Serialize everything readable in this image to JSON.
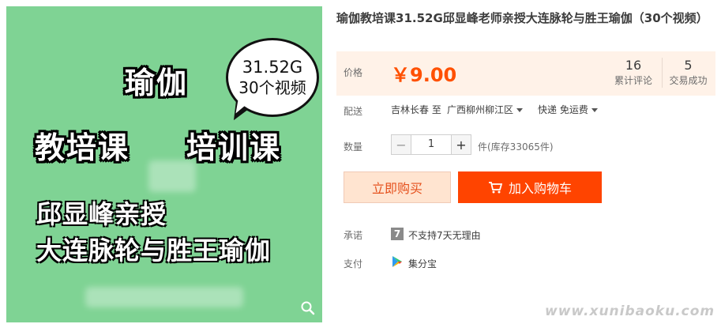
{
  "product_image": {
    "bubble_line1": "31.52G",
    "bubble_line2": "30个视频",
    "title_line1": "瑜伽",
    "title_line2a": "教培课",
    "title_line2b": "培训课",
    "subtitle_line1": "邱显峰亲授",
    "subtitle_line2": "大连脉轮与胜王瑜伽",
    "background_color": "#7fd394"
  },
  "product": {
    "title": "瑜伽教培课31.52G邱显峰老师亲授大连脉轮与胜王瑜伽（30个视频）"
  },
  "price": {
    "label": "价格",
    "value": "￥9.00",
    "reviews_count": "16",
    "reviews_label": "累计评论",
    "sales_count": "5",
    "sales_label": "交易成功",
    "accent_color": "#ff5000"
  },
  "shipping": {
    "label": "配送",
    "from": "吉林长春 至",
    "to": "广西柳州柳江区",
    "method": "快递 免运费"
  },
  "quantity": {
    "label": "数量",
    "value": "1",
    "decrement": "−",
    "increment": "+",
    "stock": "件(库存33065件)"
  },
  "actions": {
    "buy_now": "立即购买",
    "add_to_cart": "加入购物车",
    "cart_color": "#ff4400"
  },
  "promise": {
    "label": "承诺",
    "icon_text": "7",
    "text": "不支持7天无理由"
  },
  "payment": {
    "label": "支付",
    "text": "集分宝"
  },
  "watermark": "www.xunibaoku.com"
}
